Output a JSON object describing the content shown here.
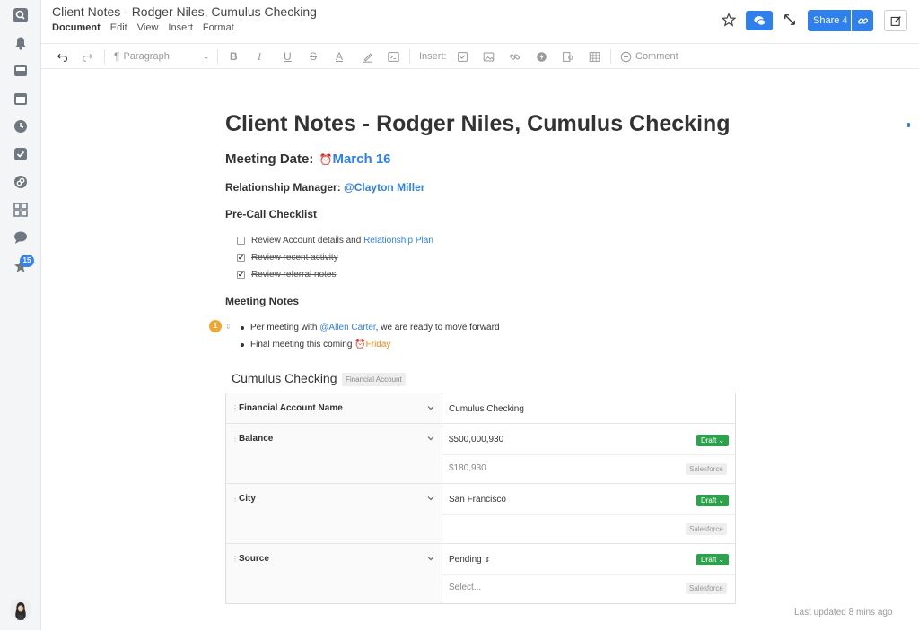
{
  "app": {
    "title": "Client Notes - Rodger Niles, Cumulus Checking",
    "menu": [
      "Document",
      "Edit",
      "View",
      "Insert",
      "Format"
    ]
  },
  "sidebar": {
    "icons": [
      "search-icon",
      "bell-icon",
      "inbox-icon",
      "calendar-icon",
      "clock-icon",
      "checkbox-icon",
      "link-icon",
      "grid-icon",
      "chat-icon",
      "star-icon"
    ],
    "star_badge": "15"
  },
  "header": {
    "share_label": "Share",
    "share_count": "4"
  },
  "toolbar": {
    "paragraph_label": "Paragraph",
    "insert_label": "Insert:",
    "comment_label": "Comment"
  },
  "doc": {
    "title": "Client Notes - Rodger Niles, Cumulus Checking",
    "meeting_date_label": "Meeting Date:",
    "meeting_date_value": "March 16",
    "rm_label": "Relationship Manager:",
    "rm_value": "@Clayton Miller",
    "checklist_heading": "Pre-Call Checklist",
    "checklist": [
      {
        "prefix": "Review Account details and ",
        "link": "Relationship Plan",
        "checked": false
      },
      {
        "prefix": "Review recent activity",
        "link": "",
        "checked": true
      },
      {
        "prefix": "Review referral notes",
        "link": "",
        "checked": true
      }
    ],
    "notes_heading": "Meeting Notes",
    "comment_count": "1",
    "bullets": [
      {
        "pre": "Per meeting with ",
        "mention": "@Allen Carter",
        "post": ", we are ready to move forward"
      },
      {
        "pre": "Final meeting this coming ",
        "date": "Friday"
      }
    ]
  },
  "card": {
    "title": "Cumulus Checking",
    "type": "Financial Account",
    "rows": [
      {
        "label": "Financial Account Name",
        "value": "Cumulus Checking"
      },
      {
        "label": "Balance",
        "value": "$500,000,930",
        "status": "Draft",
        "sf_value": "$180,930",
        "sf_label": "Salesforce"
      },
      {
        "label": "City",
        "value": "San Francisco",
        "status": "Draft",
        "sf_value": "",
        "sf_label": "Salesforce"
      },
      {
        "label": "Source",
        "value": "Pending",
        "status": "Draft",
        "sf_value": "Select...",
        "sf_label": "Salesforce"
      }
    ]
  },
  "footer": {
    "last_updated": "Last updated 8 mins ago"
  },
  "colors": {
    "accent": "#2f80ed",
    "draft": "#2ca24c",
    "mention_date": "#e88a1a"
  }
}
